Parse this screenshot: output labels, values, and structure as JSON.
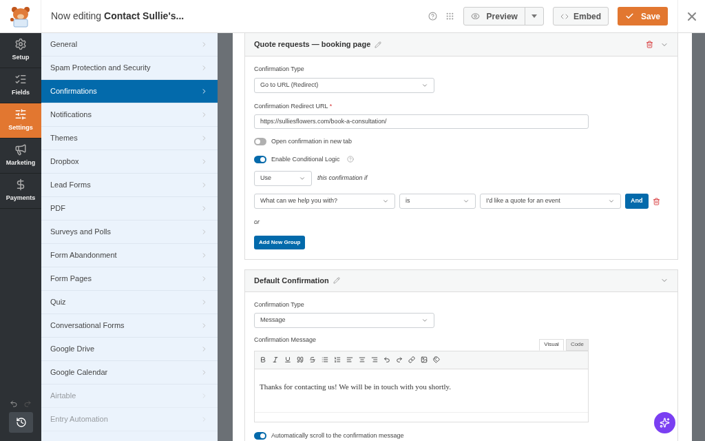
{
  "header": {
    "prefix": "Now editing",
    "form_title": "Contact Sullie's...",
    "preview": "Preview",
    "embed": "Embed",
    "save": "Save"
  },
  "nav": [
    {
      "kind": "setup",
      "label": "Setup",
      "selected": false
    },
    {
      "kind": "fields",
      "label": "Fields",
      "selected": false
    },
    {
      "kind": "settings",
      "label": "Settings",
      "selected": true
    },
    {
      "kind": "marketing",
      "label": "Marketing",
      "selected": false
    },
    {
      "kind": "payments",
      "label": "Payments",
      "selected": false
    }
  ],
  "settings_menu": [
    {
      "label": "General",
      "selected": false,
      "disabled": false
    },
    {
      "label": "Spam Protection and Security",
      "selected": false,
      "disabled": false
    },
    {
      "label": "Confirmations",
      "selected": true,
      "disabled": false
    },
    {
      "label": "Notifications",
      "selected": false,
      "disabled": false
    },
    {
      "label": "Themes",
      "selected": false,
      "disabled": false
    },
    {
      "label": "Dropbox",
      "selected": false,
      "disabled": false
    },
    {
      "label": "Lead Forms",
      "selected": false,
      "disabled": false
    },
    {
      "label": "PDF",
      "selected": false,
      "disabled": false
    },
    {
      "label": "Surveys and Polls",
      "selected": false,
      "disabled": false
    },
    {
      "label": "Form Abandonment",
      "selected": false,
      "disabled": false
    },
    {
      "label": "Form Pages",
      "selected": false,
      "disabled": false
    },
    {
      "label": "Quiz",
      "selected": false,
      "disabled": false
    },
    {
      "label": "Conversational Forms",
      "selected": false,
      "disabled": false
    },
    {
      "label": "Google Drive",
      "selected": false,
      "disabled": false
    },
    {
      "label": "Google Calendar",
      "selected": false,
      "disabled": false
    },
    {
      "label": "Airtable",
      "selected": false,
      "disabled": true
    },
    {
      "label": "Entry Automation",
      "selected": false,
      "disabled": true
    }
  ],
  "quote_confirmation": {
    "title": "Quote requests — booking page",
    "type_label": "Confirmation Type",
    "type_value": "Go to URL (Redirect)",
    "url_label": "Confirmation Redirect URL",
    "required_mark": "*",
    "url_value": "https://sulliesflowers.com/book-a-consultation/",
    "toggles": [
      {
        "label": "Open confirmation in new tab",
        "on": false,
        "help": false
      },
      {
        "label": "Enable Conditional Logic",
        "on": true,
        "help": true
      }
    ],
    "use_value": "Use",
    "use_suffix": "this confirmation if",
    "rule": {
      "field": "What can we help you with?",
      "operator": "is",
      "value": "I'd like a quote for an event",
      "and": "And"
    },
    "or": "or",
    "add_group": "Add New Group"
  },
  "default_confirmation": {
    "title": "Default Confirmation",
    "type_label": "Confirmation Type",
    "type_value": "Message",
    "message_label": "Confirmation Message",
    "tabs": [
      {
        "label": "Visual",
        "selected": true
      },
      {
        "label": "Code",
        "selected": false
      }
    ],
    "message": "Thanks for contacting us! We will be in touch with you shortly.",
    "toggles": [
      {
        "label": "Automatically scroll to the confirmation message",
        "on": true
      }
    ]
  }
}
